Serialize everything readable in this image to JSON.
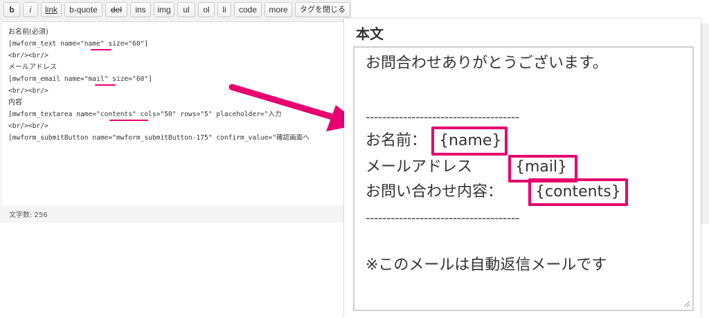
{
  "toolbar": {
    "buttons": [
      "b",
      "i",
      "link",
      "b-quote",
      "del",
      "ins",
      "img",
      "ul",
      "ol",
      "li",
      "code",
      "more",
      "タグを閉じる"
    ]
  },
  "editor": {
    "lines": [
      "お名前(必須)",
      "[mwform_text name=\"name\" size=\"60\"]",
      "<br/><br/>",
      "メールアドレス",
      "[mwform_email name=\"mail\" size=\"60\"]",
      "<br/><br/>",
      "内容",
      "[mwform_textarea name=\"contents\" cols=\"50\" rows=\"5\" placeholder=\"入力",
      "<br/><br/>",
      "[mwform_submitButton name=\"mwform_submitButton-175\" confirm_value=\"確認画面へ"
    ],
    "word_count": "文字数: 256"
  },
  "panel": {
    "label": "本文",
    "greeting": "お問合わせありがとうございます。",
    "divider": "-------------------------------------",
    "name_label": "お名前：",
    "name_tag": "{name}",
    "mail_label": "メールアドレス",
    "mail_tag": "{mail}",
    "contents_label": "お問い合わせ内容：",
    "contents_tag": "{contents}",
    "footer": "※このメールは自動返信メールです"
  },
  "colors": {
    "accent": "#e6006f",
    "text": "#333333"
  }
}
